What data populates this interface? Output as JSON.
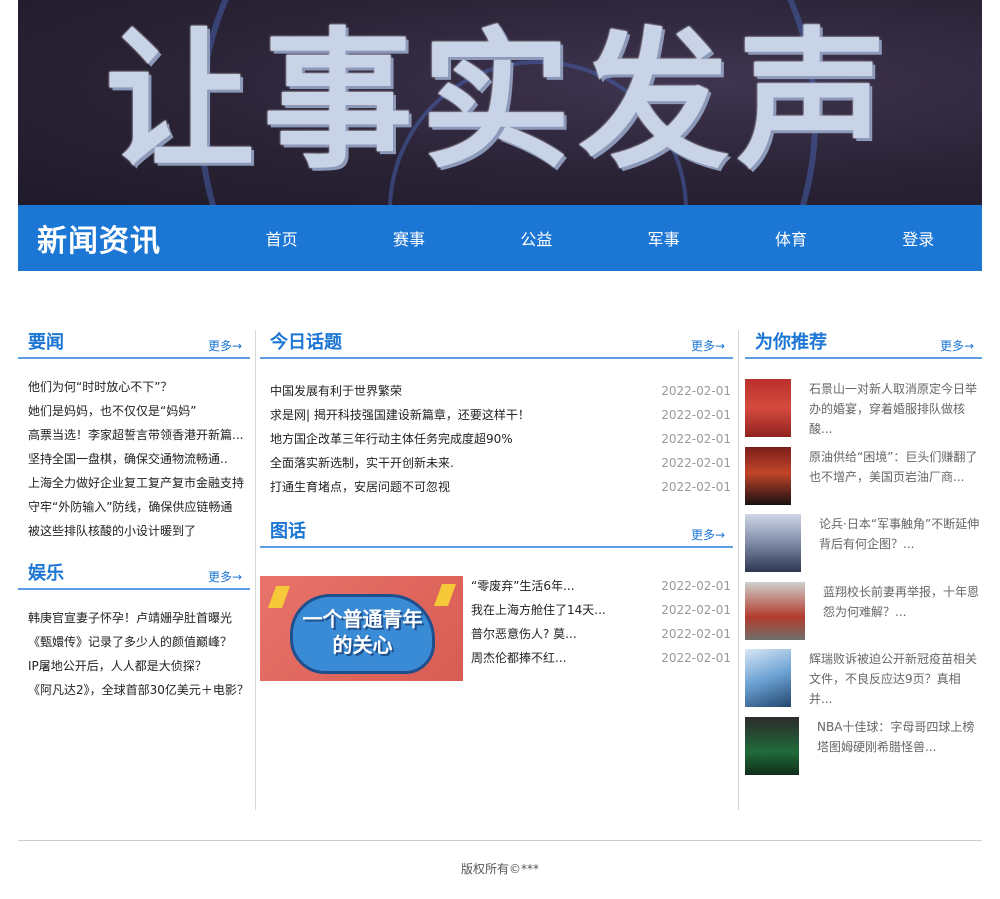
{
  "banner": {
    "title": "让事实发声"
  },
  "header": {
    "logo": "新闻资讯",
    "nav": [
      "首页",
      "赛事",
      "公益",
      "军事",
      "体育",
      "登录"
    ]
  },
  "colors": {
    "accent": "#1c76d4",
    "rule": "#5c9edf",
    "date": "#999999"
  },
  "sections": {
    "yaowen": {
      "title": "要闻",
      "more": "更多→",
      "items": [
        "他们为何“时时放心不下”？",
        "她们是妈妈，也不仅仅是“妈妈”",
        "高票当选！李家超誓言带领香港开新篇...",
        "坚持全国一盘棋，确保交通物流畅通..",
        "上海全力做好企业复工复产复市金融支持",
        "守牢“外防输入”防线，确保供应链畅通",
        "被这些排队核酸的小设计暖到了"
      ]
    },
    "yule": {
      "title": "娱乐",
      "more": "更多→",
      "items": [
        "韩庚官宣妻子怀孕！卢靖姗孕肚首曝光",
        "《甄嬛传》记录了多少人的颜值巅峰？",
        "IP屠地公开后，人人都是大侦探？",
        "《阿凡达2》，全球首部30亿美元＋电影？"
      ]
    },
    "today": {
      "title": "今日话题",
      "more": "更多→",
      "items": [
        {
          "title": "中国发展有利于世界繁荣",
          "date": "2022-02-01"
        },
        {
          "title": "求是网| 揭开科技强国建设新篇章，还要这样干！",
          "date": "2022-02-01"
        },
        {
          "title": "地方国企改革三年行动主体任务完成度超90%",
          "date": "2022-02-01"
        },
        {
          "title": "全面落实新选制，实干开创新未来.",
          "date": "2022-02-01"
        },
        {
          "title": "打通生育堵点，安居问题不可忽视",
          "date": "2022-02-01"
        }
      ]
    },
    "tuhua": {
      "title": "图话",
      "more": "更多→",
      "image_caption": "一个普通青年的关心",
      "items": [
        {
          "title": "“零废弃”生活6年...",
          "date": "2022-02-01"
        },
        {
          "title": "我在上海方舱住了14天...",
          "date": "2022-02-01"
        },
        {
          "title": "普尔恶意伤人? 莫...",
          "date": "2022-02-01"
        },
        {
          "title": "周杰伦都捧不红...",
          "date": "2022-02-01"
        }
      ]
    },
    "recommend": {
      "title": "为你推荐",
      "more": "更多→",
      "items": [
        {
          "thumb": "t1",
          "text": "石景山一对新人取消原定今日举办的婚宴，穿着婚服排队做核酸..."
        },
        {
          "thumb": "t2",
          "text": "原油供给“困境”：巨头们赚翻了也不增产，美国页岩油厂商..."
        },
        {
          "thumb": "t3",
          "text": "论兵·日本“军事触角”不断延伸 背后有何企图？..."
        },
        {
          "thumb": "t4",
          "text": "蓝翔校长前妻再举报，十年恩怨为何难解？..."
        },
        {
          "thumb": "t5",
          "text": "辉瑞败诉被迫公开新冠疫苗相关文件，不良反应达9页？真相并..."
        },
        {
          "thumb": "t6",
          "text": "NBA十佳球：字母哥四球上榜 塔图姆硬刚希腊怪兽..."
        }
      ]
    }
  },
  "footer": {
    "copyright": "版权所有©***"
  }
}
